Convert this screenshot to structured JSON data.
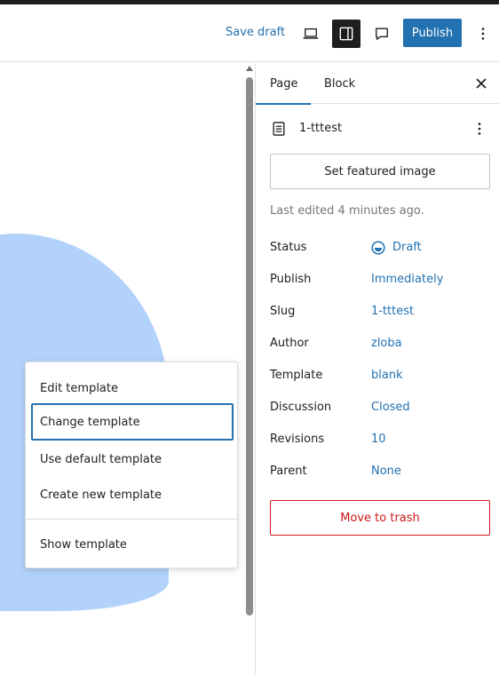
{
  "header": {
    "save_draft": "Save draft",
    "publish": "Publish",
    "icons": [
      "laptop-icon",
      "sidebar-toggle-icon",
      "comment-icon",
      "more-vertical-icon"
    ]
  },
  "context_menu": {
    "items": [
      {
        "label": "Edit template"
      },
      {
        "label": "Change template",
        "focused": true
      },
      {
        "label": "Use default template"
      },
      {
        "label": "Create new template"
      },
      {
        "label": "Show template"
      }
    ]
  },
  "sidebar": {
    "tabs": [
      {
        "label": "Page",
        "active": true
      },
      {
        "label": "Block"
      }
    ],
    "document_title": "1-tttest",
    "featured_image_button": "Set featured image",
    "last_edited": "Last edited 4 minutes ago.",
    "properties": [
      {
        "label": "Status",
        "value": "Draft"
      },
      {
        "label": "Publish",
        "value": "Immediately"
      },
      {
        "label": "Slug",
        "value": "1-tttest"
      },
      {
        "label": "Author",
        "value": "zloba"
      },
      {
        "label": "Template",
        "value": "blank"
      },
      {
        "label": "Discussion",
        "value": "Closed"
      },
      {
        "label": "Revisions",
        "value": "10"
      },
      {
        "label": "Parent",
        "value": "None"
      }
    ],
    "trash_button": "Move to trash"
  },
  "colors": {
    "accent": "#2271b1",
    "danger": "#cc1818",
    "blob": "#b3d2fb",
    "dark": "#1e1e1e"
  }
}
